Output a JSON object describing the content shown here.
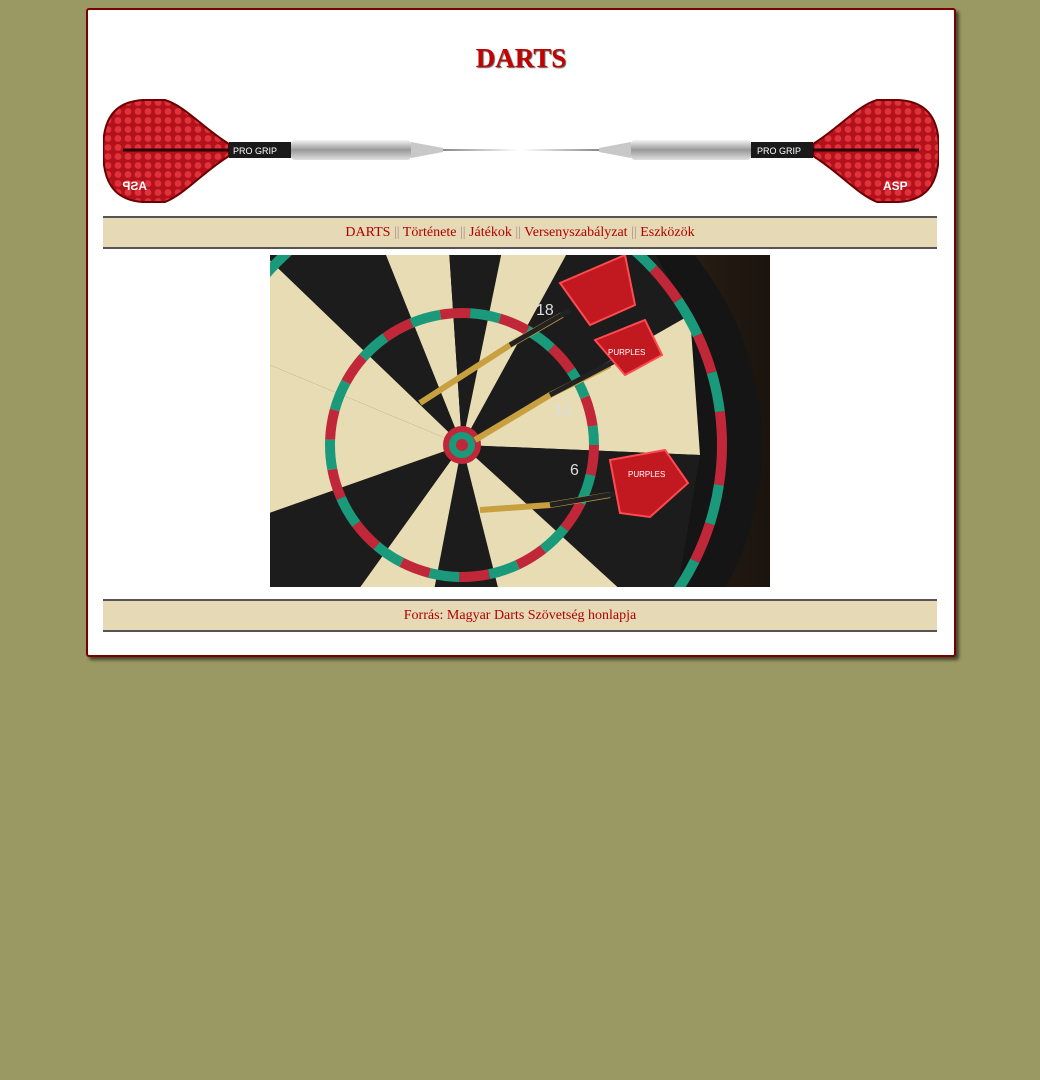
{
  "page": {
    "title": "DARTS"
  },
  "banner": {
    "left_flight_logo": "ASP",
    "right_flight_logo": "ASP",
    "left_grip_text": "PRO GRIP",
    "right_grip_text": "PRO GRIP"
  },
  "nav": {
    "separator": "||",
    "items": [
      {
        "label": "DARTS"
      },
      {
        "label": "Története"
      },
      {
        "label": "Játékok"
      },
      {
        "label": "Versenyszabályzat"
      },
      {
        "label": "Eszközök"
      }
    ]
  },
  "photo": {
    "flight_brand": "PURPLES",
    "board_numbers": [
      "18",
      "13",
      "6"
    ]
  },
  "footer": {
    "source_text": "Forrás: Magyar Darts Szövetség honlapja"
  },
  "colors": {
    "background": "#9a9963",
    "card_border": "#7a0000",
    "title": "#c40000",
    "bar_background": "#e6d9b6",
    "link": "#b00000"
  }
}
